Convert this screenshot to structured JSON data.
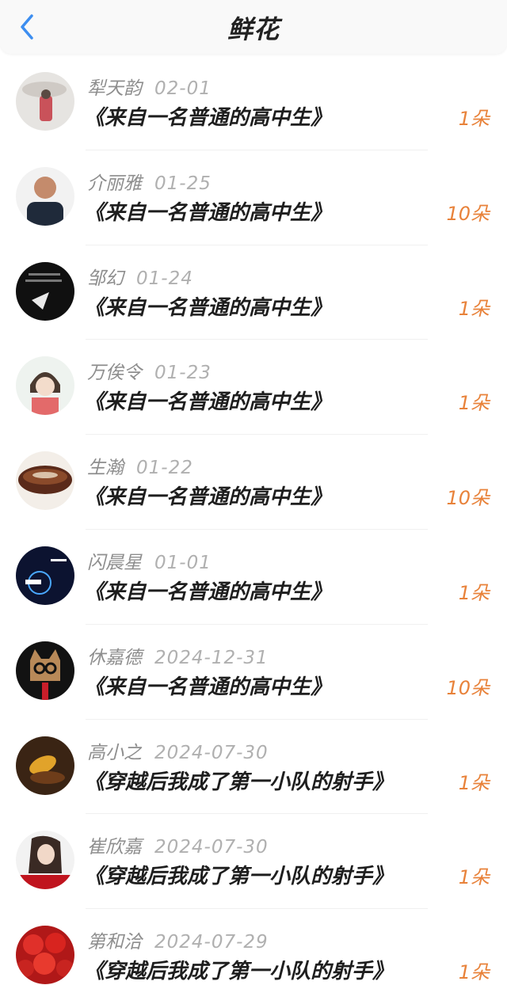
{
  "header": {
    "title": "鲜花"
  },
  "list": [
    {
      "user": "犁天韵",
      "date": "02-01",
      "book": "《来自一名普通的高中生》",
      "amount": "1朵"
    },
    {
      "user": "介丽雅",
      "date": "01-25",
      "book": "《来自一名普通的高中生》",
      "amount": "10朵"
    },
    {
      "user": "邹幻",
      "date": "01-24",
      "book": "《来自一名普通的高中生》",
      "amount": "1朵"
    },
    {
      "user": "万俟令",
      "date": "01-23",
      "book": "《来自一名普通的高中生》",
      "amount": "1朵"
    },
    {
      "user": "生瀚",
      "date": "01-22",
      "book": "《来自一名普通的高中生》",
      "amount": "10朵"
    },
    {
      "user": "闪晨星",
      "date": "01-01",
      "book": "《来自一名普通的高中生》",
      "amount": "1朵"
    },
    {
      "user": "休嘉德",
      "date": "2024-12-31",
      "book": "《来自一名普通的高中生》",
      "amount": "10朵"
    },
    {
      "user": "高小之",
      "date": "2024-07-30",
      "book": "《穿越后我成了第一小队的射手》",
      "amount": "1朵"
    },
    {
      "user": "崔欣嘉",
      "date": "2024-07-30",
      "book": "《穿越后我成了第一小队的射手》",
      "amount": "1朵"
    },
    {
      "user": "第和洽",
      "date": "2024-07-29",
      "book": "《穿越后我成了第一小队的射手》",
      "amount": "1朵"
    }
  ],
  "colors": {
    "accent": "#e8823a",
    "back_icon": "#3d8ef0"
  }
}
